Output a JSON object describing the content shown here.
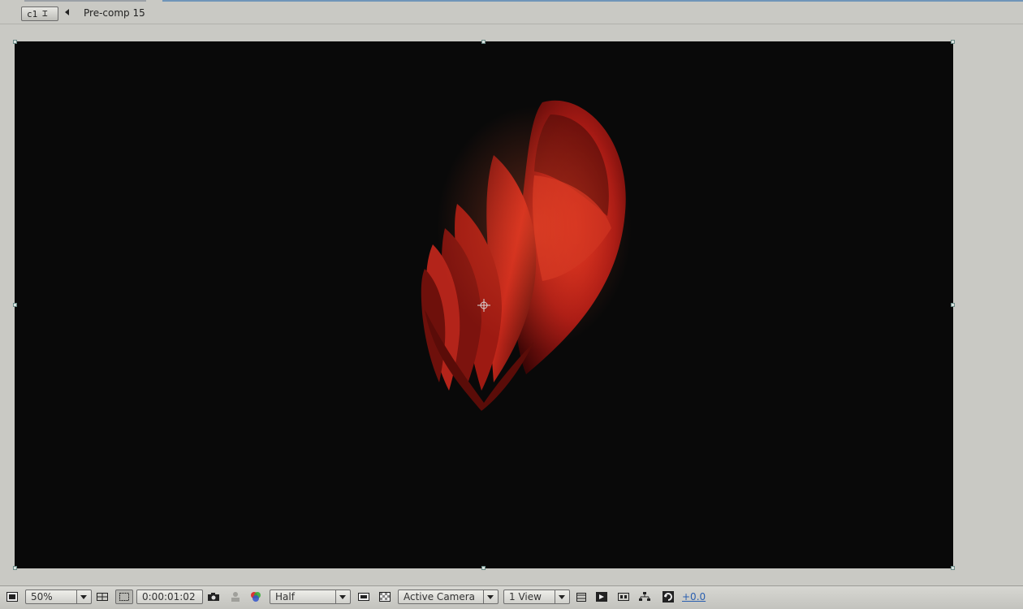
{
  "breadcrumb": {
    "comp_button_label": "c1",
    "current_comp": "Pre-comp 15"
  },
  "toolbar": {
    "magnification": "50%",
    "timecode": "0:00:01:02",
    "resolution": "Half",
    "camera": "Active Camera",
    "views": "1 View",
    "exposure": "+0.0"
  },
  "colors": {
    "panel_bg": "#c9c9c4",
    "comp_bg": "#090909",
    "flower_red": "#c0231c",
    "exposure_link": "#2a5fb0"
  }
}
